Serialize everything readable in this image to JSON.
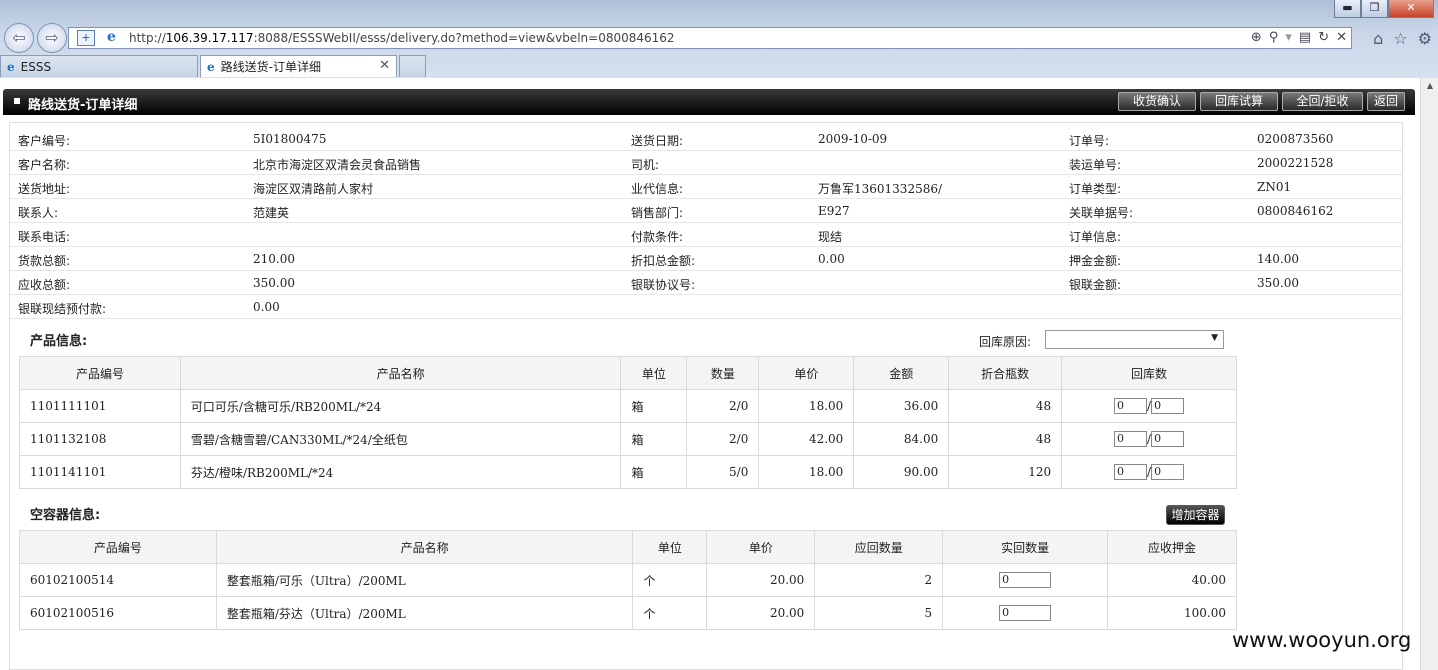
{
  "browser": {
    "url_prefix": "http://",
    "url_host": "106.39.17.117",
    "url_rest": ":8088/ESSSWebII/esss/delivery.do?method=view&vbeln=0800846162",
    "tabs": [
      {
        "label": "ESSS"
      },
      {
        "label": "路线送货-订单详细"
      }
    ]
  },
  "page": {
    "title": "路线送货-订单详细",
    "buttons": {
      "confirm_receipt": "收货确认",
      "trial_return": "回库试算",
      "full_return_reject": "全回/拒收",
      "back": "返回"
    }
  },
  "info": {
    "rows": [
      [
        {
          "label": "客户编号:",
          "value": "5I01800475"
        },
        {
          "label": "送货日期:",
          "value": "2009-10-09"
        },
        {
          "label": "订单号:",
          "value": "0200873560"
        }
      ],
      [
        {
          "label": "客户名称:",
          "value": "北京市海淀区双清会灵食品销售"
        },
        {
          "label": "司机:",
          "value": ""
        },
        {
          "label": "装运单号:",
          "value": "2000221528"
        }
      ],
      [
        {
          "label": "送货地址:",
          "value": "海淀区双清路前人家村"
        },
        {
          "label": "业代信息:",
          "value": "万鲁军13601332586/"
        },
        {
          "label": "订单类型:",
          "value": "ZN01"
        }
      ],
      [
        {
          "label": "联系人:",
          "value": "范建英"
        },
        {
          "label": "销售部门:",
          "value": "E927"
        },
        {
          "label": "关联单据号:",
          "value": "0800846162"
        }
      ],
      [
        {
          "label": "联系电话:",
          "value": ""
        },
        {
          "label": "付款条件:",
          "value": "现结"
        },
        {
          "label": "订单信息:",
          "value": ""
        }
      ],
      [
        {
          "label": "货款总额:",
          "value": "210.00"
        },
        {
          "label": "折扣总金额:",
          "value": "0.00"
        },
        {
          "label": "押金金额:",
          "value": "140.00"
        }
      ],
      [
        {
          "label": "应收总额:",
          "value": "350.00"
        },
        {
          "label": "银联协议号:",
          "value": ""
        },
        {
          "label": "银联金额:",
          "value": "350.00"
        }
      ],
      [
        {
          "label": "银联现结预付款:",
          "value": "0.00"
        }
      ]
    ]
  },
  "products": {
    "title": "产品信息:",
    "return_reason_label": "回库原因:",
    "return_reason_value": "",
    "headers": [
      "产品编号",
      "产品名称",
      "单位",
      "数量",
      "单价",
      "金额",
      "折合瓶数",
      "回库数"
    ],
    "rows": [
      {
        "code": "1101111101",
        "name": "可口可乐/含糖可乐/RB200ML/*24",
        "unit": "箱",
        "qty": "2/0",
        "price": "18.00",
        "amount": "36.00",
        "bottles": "48",
        "ret_a": "0",
        "ret_b": "0"
      },
      {
        "code": "1101132108",
        "name": "雪碧/含糖雪碧/CAN330ML/*24/全纸包",
        "unit": "箱",
        "qty": "2/0",
        "price": "42.00",
        "amount": "84.00",
        "bottles": "48",
        "ret_a": "0",
        "ret_b": "0"
      },
      {
        "code": "1101141101",
        "name": "芬达/橙味/RB200ML/*24",
        "unit": "箱",
        "qty": "5/0",
        "price": "18.00",
        "amount": "90.00",
        "bottles": "120",
        "ret_a": "0",
        "ret_b": "0"
      }
    ]
  },
  "containers": {
    "title": "空容器信息:",
    "add_button": "增加容器",
    "headers": [
      "产品编号",
      "产品名称",
      "单位",
      "单价",
      "应回数量",
      "实回数量",
      "应收押金"
    ],
    "rows": [
      {
        "code": "60102100514",
        "name": "整套瓶箱/可乐（Ultra）/200ML",
        "unit": "个",
        "price": "20.00",
        "expected": "2",
        "actual": "0",
        "deposit": "40.00"
      },
      {
        "code": "60102100516",
        "name": "整套瓶箱/芬达（Ultra）/200ML",
        "unit": "个",
        "price": "20.00",
        "expected": "5",
        "actual": "0",
        "deposit": "100.00"
      }
    ]
  },
  "watermark": "www.wooyun.org"
}
